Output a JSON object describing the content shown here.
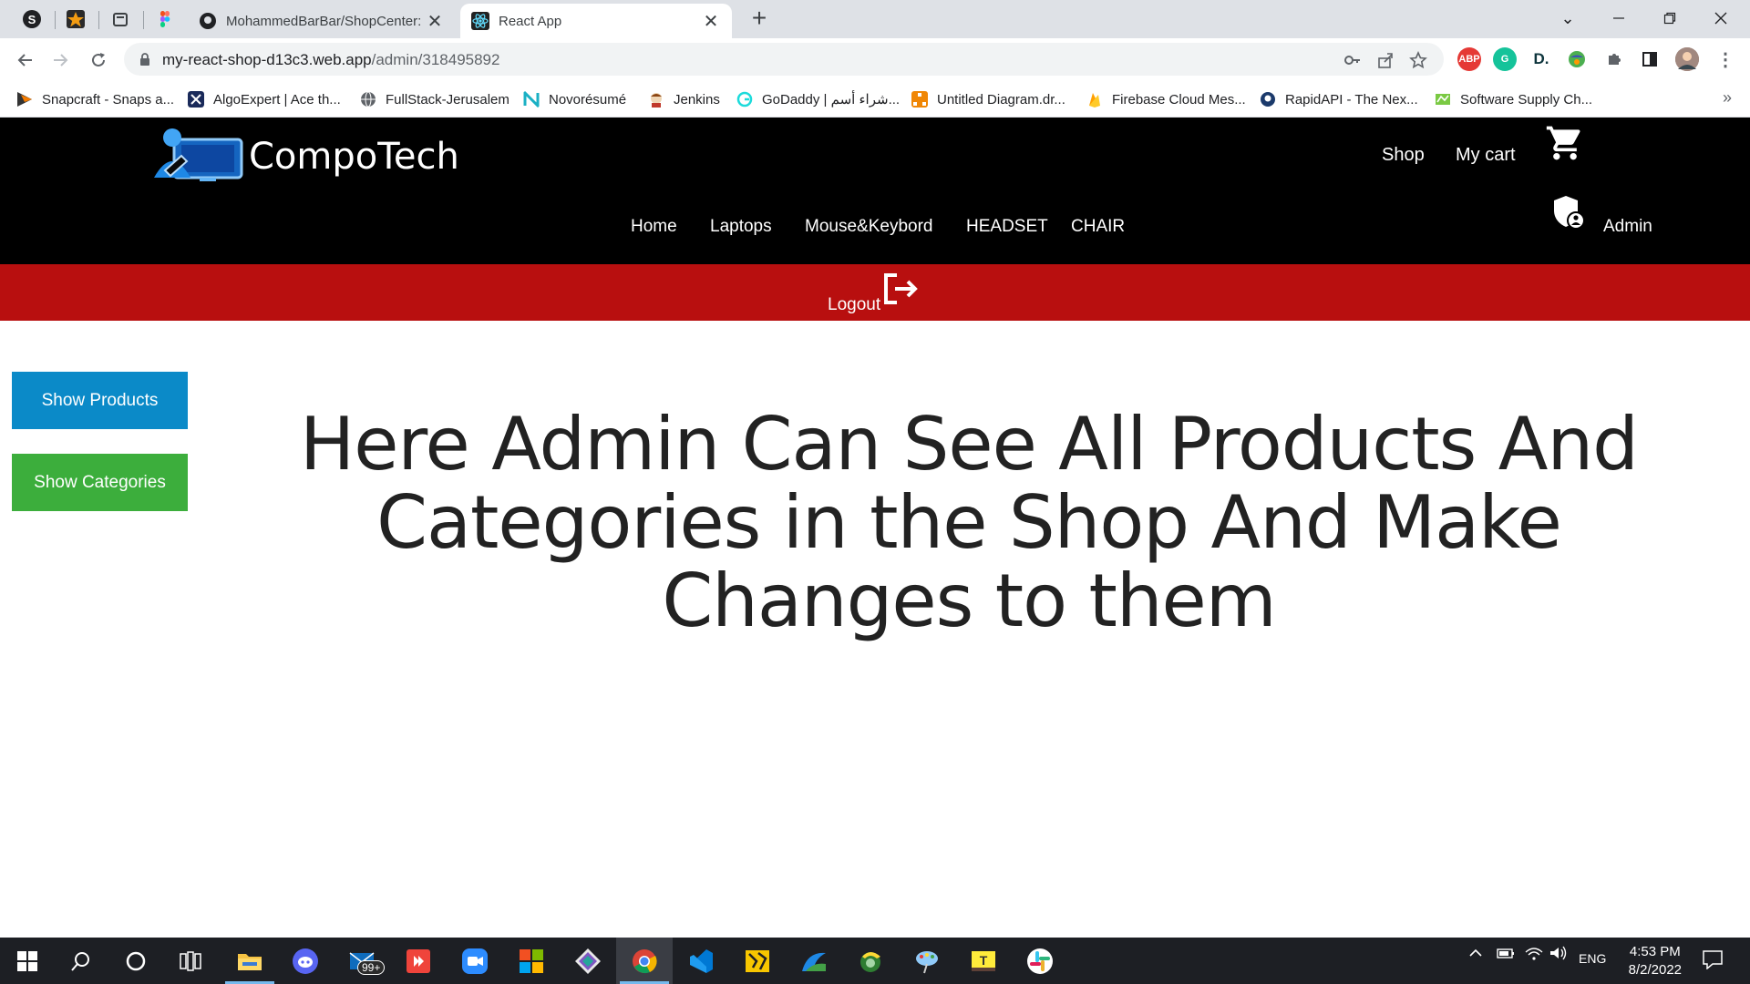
{
  "browser": {
    "tabs": [
      {
        "title": "MohammedBarBar/ShopCenter: ",
        "close": "✕",
        "active": false
      },
      {
        "title": "React App",
        "close": "✕",
        "active": true
      }
    ],
    "new_tab": "+",
    "url_host": "my-react-shop-d13c3.web.app",
    "url_path": "/admin/318495892",
    "bookmarks": [
      {
        "label": "Snapcraft - Snaps a...",
        "icon_color": "#333333"
      },
      {
        "label": "AlgoExpert | Ace th...",
        "icon_color": "#1a2a5a"
      },
      {
        "label": "FullStack-Jerusalem",
        "icon_color": "#5f6368"
      },
      {
        "label": "Novorésumé",
        "icon_color": "#1ab0c4"
      },
      {
        "label": "Jenkins",
        "icon_color": "#c0392b"
      },
      {
        "label": "GoDaddy | شراء أسم...",
        "icon_color": "#1bdbdb"
      },
      {
        "label": "Untitled Diagram.dr...",
        "icon_color": "#f08705"
      },
      {
        "label": "Firebase Cloud Mes...",
        "icon_color": "#ffca28"
      },
      {
        "label": "RapidAPI - The Nex...",
        "icon_color": "#1b3a6b"
      },
      {
        "label": "Software Supply Ch...",
        "icon_color": "#7ac943"
      }
    ],
    "bookmarks_more": "»",
    "extensions": [
      {
        "name": "adblock-icon",
        "label": "ABP",
        "color": "#e53935"
      },
      {
        "name": "grammarly-icon",
        "label": "G",
        "color": "#15c39a"
      },
      {
        "name": "dashlane-icon",
        "label": "D.",
        "color": "#ffffff"
      }
    ]
  },
  "site": {
    "brand": "CompoTech",
    "top_links": {
      "shop": "Shop",
      "cart": "My cart"
    },
    "nav": [
      "Home",
      "Laptops",
      "Mouse&Keybord",
      "HEADSET",
      "CHAIR"
    ],
    "admin_label": "Admin",
    "logout_label": "Logout",
    "buttons": {
      "show_products": "Show Products",
      "show_categories": "Show Categories"
    },
    "hero_text": "Here Admin Can See All Products And Categories in the Shop And Make Changes to them",
    "colors": {
      "header_bg": "#000000",
      "logout_bar": "#b80f0f",
      "products_btn": "#0b8ac8",
      "categories_btn": "#3cae3c"
    }
  },
  "taskbar": {
    "mail_badge": "99+",
    "language": "ENG",
    "time": "4:53 PM",
    "date": "8/2/2022"
  }
}
